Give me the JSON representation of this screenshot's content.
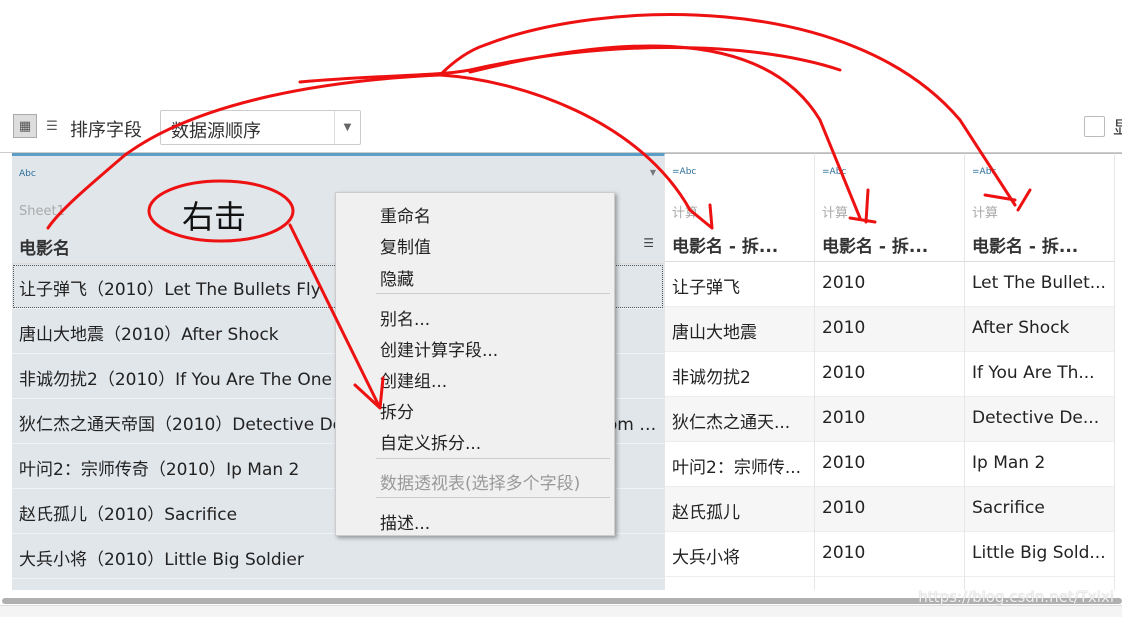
{
  "toolbar": {
    "sort_label": "排序字段",
    "sort_value": "数据源顺序",
    "show_label_partial": "显"
  },
  "columns": [
    {
      "type": "Abc",
      "source": "Sheet1",
      "name": "电影名"
    },
    {
      "type": "=Abc",
      "source": "计算",
      "name": "电影名 - 拆..."
    },
    {
      "type": "=Abc",
      "source": "计算",
      "name": "电影名 - 拆..."
    },
    {
      "type": "=Abc",
      "source": "计算",
      "name": "电影名 - 拆..."
    }
  ],
  "rows": [
    [
      "让子弹飞（2010）Let The Bullets Fly",
      "让子弹飞",
      "2010",
      "Let The Bullet..."
    ],
    [
      "唐山大地震（2010）After Shock",
      "唐山大地震",
      "2010",
      "After Shock"
    ],
    [
      "非诚勿扰2（2010）If You Are The One 2",
      "非诚勿扰2",
      "2010",
      "If You Are Th..."
    ],
    [
      "狄仁杰之通天帝国（2010）Detective Dee and the Mystery of the Phantom Flame to...",
      "狄仁杰之通天...",
      "2010",
      "Detective De..."
    ],
    [
      "叶问2：宗师传奇（2010）Ip Man 2",
      "叶问2：宗师传...",
      "2010",
      "Ip Man 2"
    ],
    [
      "赵氏孤儿（2010）Sacrifice",
      "赵氏孤儿",
      "2010",
      "Sacrifice"
    ],
    [
      "大兵小将（2010）Little Big Soldier",
      "大兵小将",
      "2010",
      "Little Big Sold..."
    ]
  ],
  "context_menu": {
    "items": [
      {
        "label": "重命名"
      },
      {
        "label": "复制值"
      },
      {
        "label": "隐藏"
      },
      {
        "label": "别名..."
      },
      {
        "label": "创建计算字段..."
      },
      {
        "label": "创建组..."
      },
      {
        "label": "拆分"
      },
      {
        "label": "自定义拆分..."
      },
      {
        "label": "数据透视表(选择多个字段)",
        "disabled": true
      },
      {
        "label": "描述..."
      }
    ]
  },
  "annotation": {
    "text": "右击",
    "color": "#ee1111"
  },
  "watermark": "https://blog.csdn.net/Txixi"
}
